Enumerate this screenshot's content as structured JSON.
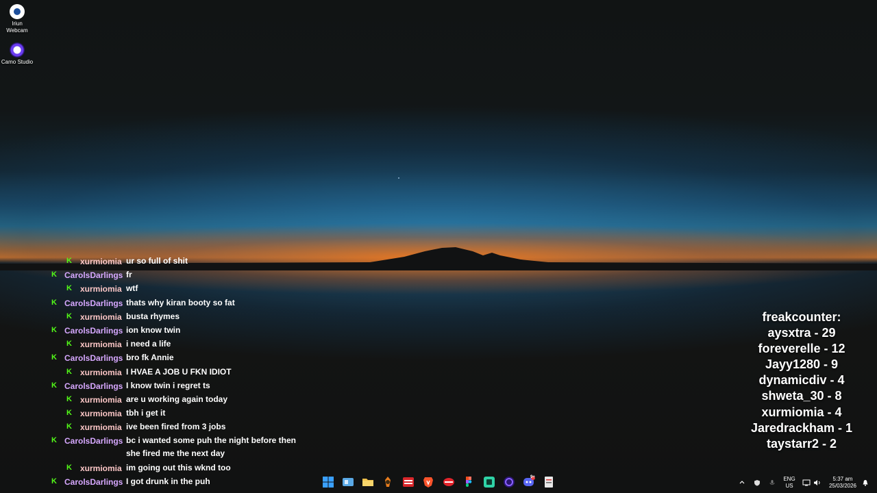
{
  "desktop_icons": [
    {
      "label_line1": "Iriun",
      "label_line2": "Webcam",
      "icon": "iriun-webcam-icon"
    },
    {
      "label_line1": "Camo Studio",
      "label_line2": "",
      "icon": "camo-studio-icon"
    }
  ],
  "chat": [
    {
      "user": "xurmiomia",
      "text": "ur so full of shit"
    },
    {
      "user": "CarolsDarlings",
      "text": "fr"
    },
    {
      "user": "xurmiomia",
      "text": "wtf"
    },
    {
      "user": "CarolsDarlings",
      "text": "thats why kiran booty so fat"
    },
    {
      "user": "xurmiomia",
      "text": "busta rhymes"
    },
    {
      "user": "CarolsDarlings",
      "text": "ion know twin"
    },
    {
      "user": "xurmiomia",
      "text": "i need a life"
    },
    {
      "user": "CarolsDarlings",
      "text": "bro fk Annie"
    },
    {
      "user": "xurmiomia",
      "text": "I HVAE A JOB U FKN IDIOT"
    },
    {
      "user": "CarolsDarlings",
      "text": "I know twin i regret ts"
    },
    {
      "user": "xurmiomia",
      "text": "are u working again today"
    },
    {
      "user": "xurmiomia",
      "text": "tbh i get it"
    },
    {
      "user": "xurmiomia",
      "text": "ive been fired from 3 jobs"
    },
    {
      "user": "CarolsDarlings",
      "text": "bc i wanted some puh the night before then she fired me the next day"
    },
    {
      "user": "xurmiomia",
      "text": "im going out this wknd too"
    },
    {
      "user": "CarolsDarlings",
      "text": "I got drunk in the puh"
    }
  ],
  "chat_badge": "K",
  "freakcounter": {
    "title": "freakcounter:",
    "entries": [
      "aysxtra - 29",
      "foreverelle - 12",
      "Jayy1280 - 9",
      "dynamicdiv - 4",
      "shweta_30 - 8",
      "xurmiomia - 4",
      "Jaredrackham - 1",
      "taystarr2 - 2"
    ]
  },
  "taskbar": {
    "apps": [
      "windows-start-icon",
      "widgets-icon",
      "file-explorer-icon",
      "app-icon",
      "vivid-icon",
      "brave-icon",
      "app-red-icon",
      "figma-icon",
      "app-teal-icon",
      "camo-icon",
      "discord-icon",
      "app-doc-icon"
    ],
    "discord_badge": "9+",
    "tray": {
      "lang_top": "ENG",
      "lang_bottom": "US",
      "time": "5:37 am",
      "date": "25/03/2026"
    }
  },
  "colors": {
    "kick_green": "#53fc18",
    "user_pink": "#fbc6c6",
    "user_purple": "#d7a8ff"
  }
}
